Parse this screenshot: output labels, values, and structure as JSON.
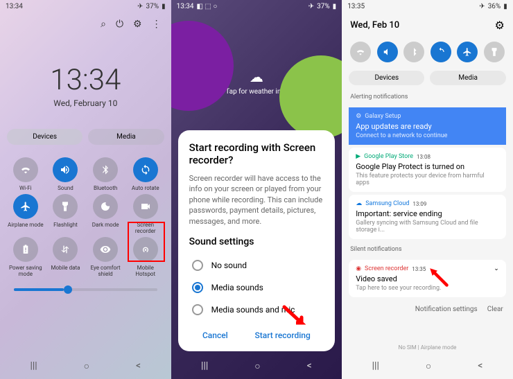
{
  "phone1": {
    "status_time": "13:34",
    "battery": "37%",
    "clock_time": "13:34",
    "clock_date": "Wed, February 10",
    "tabs": {
      "devices": "Devices",
      "media": "Media"
    },
    "qs": [
      {
        "label": "Wi-Fi",
        "icon": "wifi",
        "active": false
      },
      {
        "label": "Sound",
        "icon": "sound",
        "active": true
      },
      {
        "label": "Bluetooth",
        "icon": "bluetooth",
        "active": false
      },
      {
        "label": "Auto rotate",
        "icon": "rotate",
        "active": true
      },
      {
        "label": "Airplane mode",
        "icon": "airplane",
        "active": true
      },
      {
        "label": "Flashlight",
        "icon": "flash",
        "active": false
      },
      {
        "label": "Dark mode",
        "icon": "dark",
        "active": false
      },
      {
        "label": "Screen recorder",
        "icon": "record",
        "active": false
      },
      {
        "label": "Power saving mode",
        "icon": "power",
        "active": false
      },
      {
        "label": "Mobile data",
        "icon": "data",
        "active": false
      },
      {
        "label": "Eye comfort shield",
        "icon": "eye",
        "active": false
      },
      {
        "label": "Mobile Hotspot",
        "icon": "hotspot",
        "active": false
      }
    ]
  },
  "phone2": {
    "status_time": "13:34",
    "battery": "37%",
    "weather": "Tap for weather info",
    "dialog": {
      "title": "Start recording with Screen recorder?",
      "body": "Screen recorder will have access to the info on your screen or played from your phone while recording. This can include passwords, payment details, pictures, messages, and more.",
      "section": "Sound settings",
      "options": [
        "No sound",
        "Media sounds",
        "Media sounds and mic"
      ],
      "selected": 1,
      "cancel": "Cancel",
      "start": "Start recording"
    }
  },
  "phone3": {
    "status_time": "13:35",
    "battery": "36%",
    "date": "Wed, Feb 10",
    "tabs": {
      "devices": "Devices",
      "media": "Media"
    },
    "sections": {
      "alerting": "Alerting notifications",
      "silent": "Silent notifications"
    },
    "notifs": [
      {
        "app": "Galaxy Setup",
        "title": "App updates are ready",
        "body": "Connect to a network to continue",
        "blue": true
      },
      {
        "app": "Google Play Store",
        "time": "13:08",
        "title": "Google Play Protect is turned on",
        "body": "This feature protects your device from harmful apps"
      },
      {
        "app": "Samsung Cloud",
        "time": "13:09",
        "title": "Important: service ending",
        "body": "Gallery syncing with Samsung Cloud and file storage i..."
      },
      {
        "app": "Screen recorder",
        "time": "13:35",
        "title": "Video saved",
        "body": "Tap here to see your recording."
      }
    ],
    "footer": {
      "settings": "Notification settings",
      "clear": "Clear"
    },
    "status_footer": "No SIM | Airplane mode"
  }
}
